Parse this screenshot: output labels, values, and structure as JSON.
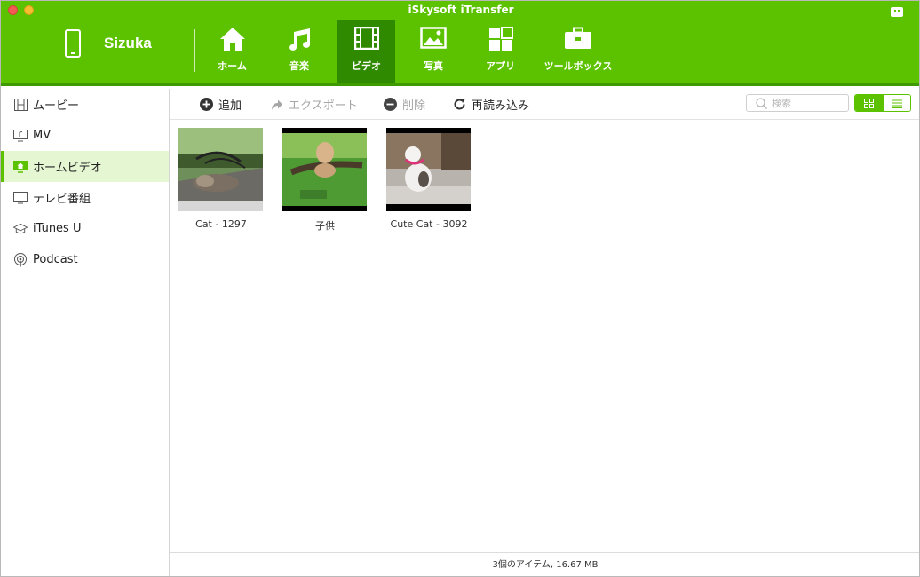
{
  "window": {
    "title": "iSkysoft iTransfer"
  },
  "device": {
    "name": "Sizuka"
  },
  "tabs": [
    {
      "label": "ホーム",
      "icon": "home-icon"
    },
    {
      "label": "音楽",
      "icon": "music-icon"
    },
    {
      "label": "ビデオ",
      "icon": "film-icon",
      "active": true
    },
    {
      "label": "写真",
      "icon": "photo-icon"
    },
    {
      "label": "アプリ",
      "icon": "apps-icon"
    },
    {
      "label": "ツールボックス",
      "icon": "toolbox-icon"
    }
  ],
  "sidebar": {
    "items": [
      {
        "label": "ムービー",
        "icon": "film-strip-icon"
      },
      {
        "label": "MV",
        "icon": "music-video-icon"
      },
      {
        "label": "ホームビデオ",
        "icon": "home-video-icon",
        "active": true
      },
      {
        "label": "テレビ番組",
        "icon": "tv-icon"
      },
      {
        "label": "iTunes U",
        "icon": "graduation-cap-icon"
      },
      {
        "label": "Podcast",
        "icon": "podcast-icon"
      }
    ]
  },
  "toolbar": {
    "add_label": "追加",
    "export_label": "エクスポート",
    "delete_label": "削除",
    "reload_label": "再読み込み",
    "search_placeholder": "検索"
  },
  "videos": [
    {
      "title": "Cat - 1297"
    },
    {
      "title": "子供"
    },
    {
      "title": "Cute Cat - 3092"
    }
  ],
  "status": {
    "text": "3個のアイテム, 16.67 MB"
  },
  "colors": {
    "accent": "#5cc200",
    "accent_dark": "#2f8a00",
    "active_row": "#e4f6d2"
  }
}
